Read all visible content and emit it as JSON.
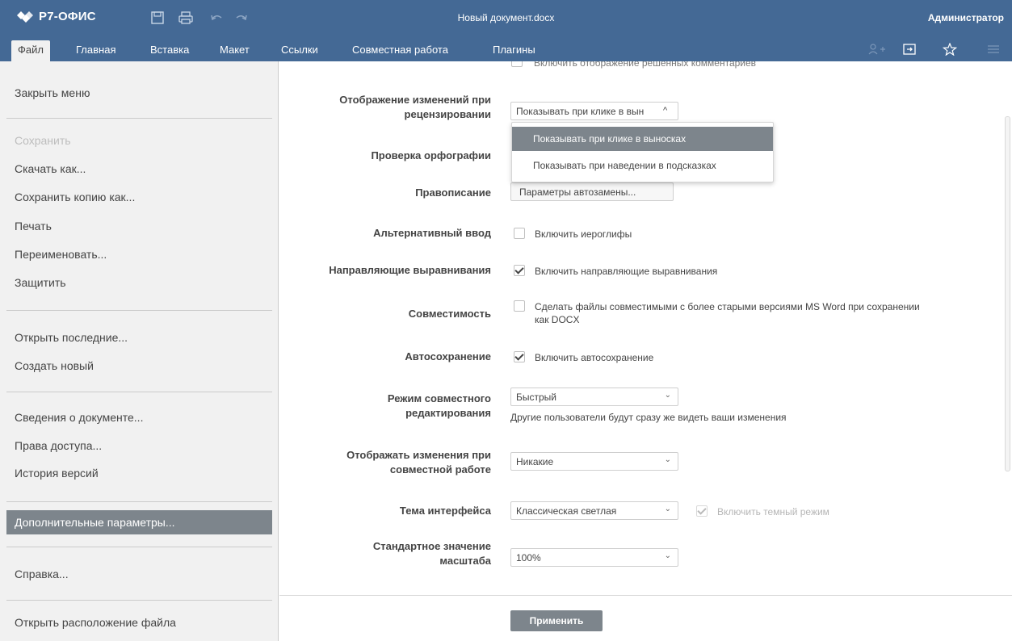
{
  "app": {
    "logo_text": "Р7-ОФИС",
    "doc_title": "Новый документ.docx",
    "user": "Администратор"
  },
  "tabs": [
    {
      "label": "Файл",
      "active": true
    },
    {
      "label": "Главная"
    },
    {
      "label": "Вставка"
    },
    {
      "label": "Макет"
    },
    {
      "label": "Ссылки"
    },
    {
      "label": "Совместная работа"
    },
    {
      "label": "Плагины"
    }
  ],
  "titlebar_icons": [
    "save-icon",
    "print-icon",
    "undo-icon",
    "redo-icon"
  ],
  "tabbar_icons": [
    "add-user-icon",
    "open-location-icon",
    "favorite-star-icon",
    "menu-icon"
  ],
  "menu": {
    "close": "Закрыть меню",
    "save": "Сохранить",
    "download_as": "Скачать как...",
    "save_copy_as": "Сохранить копию как...",
    "print": "Печать",
    "rename": "Переименовать...",
    "protect": "Защитить",
    "open_recent": "Открыть последние...",
    "create_new": "Создать новый",
    "doc_info": "Сведения о документе...",
    "access_rights": "Права доступа...",
    "version_history": "История версий",
    "advanced_settings": "Дополнительные параметры...",
    "help": "Справка...",
    "open_file_location": "Открыть расположение файла"
  },
  "settings": {
    "resolved_comments_cut": "Включить отображение решенных комментариев",
    "review_display": {
      "label_line1": "Отображение изменений при",
      "label_line2": "рецензировании",
      "value": "Показывать при клике в вын",
      "options": [
        "Показывать при клике в выносках",
        "Показывать при наведении в подсказках"
      ]
    },
    "spellcheck": {
      "label": "Проверка орфографии"
    },
    "proofing": {
      "label": "Правописание",
      "button": "Параметры автозамены..."
    },
    "alt_input": {
      "label": "Альтернативный ввод",
      "checkbox": "Включить иероглифы",
      "checked": false
    },
    "alignment_guides": {
      "label": "Направляющие выравнивания",
      "checkbox": "Включить направляющие выравнивания",
      "checked": true
    },
    "compatibility": {
      "label": "Совместимость",
      "checkbox_line1": "Сделать файлы совместимыми с более старыми версиями MS Word при сохранении",
      "checkbox_line2": "как DOCX",
      "checked": false
    },
    "autosave": {
      "label": "Автосохранение",
      "checkbox": "Включить автосохранение",
      "checked": true
    },
    "coediting": {
      "label_line1": "Режим совместного",
      "label_line2": "редактирования",
      "value": "Быстрый",
      "note": "Другие пользователи будут сразу же видеть ваши изменения"
    },
    "show_changes": {
      "label_line1": "Отображать изменения при",
      "label_line2": "совместной работе",
      "value": "Никакие"
    },
    "theme": {
      "label": "Тема интерфейса",
      "value": "Классическая светлая",
      "dark_mode": "Включить темный режим",
      "dark_checked": true
    },
    "zoom": {
      "label_line1": "Стандартное значение",
      "label_line2": "масштаба",
      "value": "100%"
    },
    "apply": "Применить"
  },
  "colors": {
    "header": "#446995",
    "selected": "#7d858c"
  }
}
